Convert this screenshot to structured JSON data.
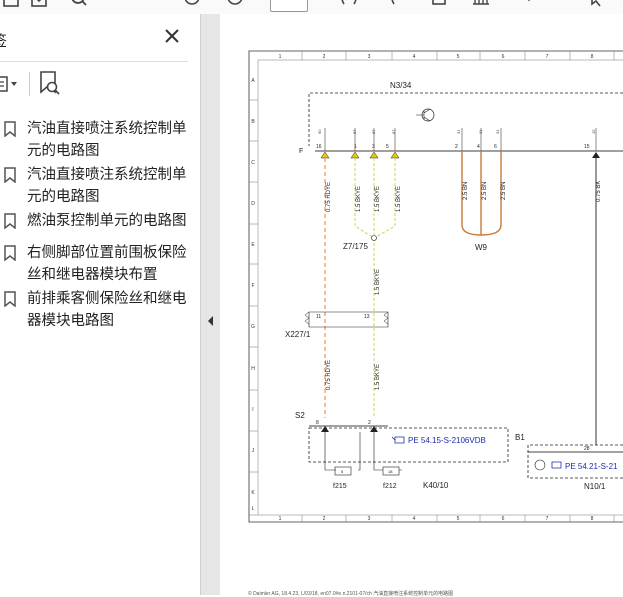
{
  "sidebar": {
    "title": "签",
    "bookmarks": [
      {
        "label": "汽油直接喷注系统控制单元的电路图"
      },
      {
        "label": "汽油直接喷注系统控制单元的电路图"
      },
      {
        "label": "燃油泵控制单元的电路图"
      },
      {
        "label": "右侧脚部位置前围板保险丝和继电器模块布置"
      },
      {
        "label": "前排乘客侧保险丝和继电器模块电路图"
      }
    ]
  },
  "diagram": {
    "col_numbers": [
      "1",
      "2",
      "3",
      "4",
      "5",
      "6",
      "7",
      "8"
    ],
    "row_letters": [
      "A",
      "B",
      "C",
      "D",
      "E",
      "F",
      "G",
      "H",
      "I",
      "J",
      "K",
      "L"
    ],
    "labels": {
      "n334": "N3/34",
      "f": "F",
      "z7": "Z7/175",
      "w9": "W9",
      "x227": "X227/1",
      "s2": "S2",
      "b1": "B1",
      "f215": "f215",
      "f212": "f212",
      "k40": "K40/10",
      "n10": "N10/1",
      "pe1": "PE 54.15-S-2106VDB",
      "pe2": "PE 54.21-S-21"
    },
    "pins": {
      "p16": "16",
      "p1": "1",
      "p3": "3",
      "p5": "5",
      "p2": "2",
      "p4": "4",
      "p6": "6",
      "p15": "15",
      "p11": "11",
      "p13": "13",
      "p8": "8",
      "p2b": "2",
      "p28": "28",
      "p5b": "5",
      "p18": "18"
    },
    "wires": {
      "w1": "0.75 RDYE",
      "w2": "1.5 BKYE",
      "w3": "1.5 BKYE",
      "w4": "1.5 BKYE",
      "w5": "2.5 BN",
      "w6": "2.5 BN",
      "w7": "2.5 BN",
      "w8": "0.75 BK",
      "w9": "1.5 BKYE",
      "w10": "0.75 RDYE",
      "w11": "1.5 BKYE"
    },
    "footer": "© Daimler AG, 18.4.23, L/03/18, en07.0#e.n.2101-07/ch 汽油直接喷注系统控制单元的电路图"
  }
}
